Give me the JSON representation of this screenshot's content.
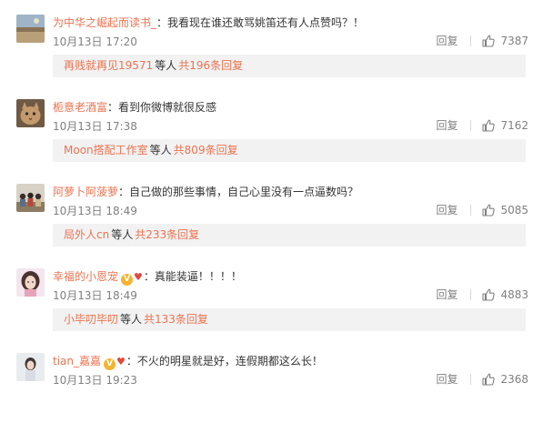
{
  "comments": [
    {
      "user": "为中华之崛起而读书_",
      "separator": "：",
      "text": "我看现在谁还敢骂姚笛还有人点赞吗？！",
      "time": "10月13日 17:20",
      "reply_label": "回复",
      "likes": "7387",
      "sub_user": "再贱就再见19571",
      "sub_mid": "等人",
      "sub_count": "共196条回复",
      "avatar_style": "landscape"
    },
    {
      "user": "栀意老酒富",
      "separator": "：",
      "text": "看到你微博就很反感",
      "time": "10月13日 17:38",
      "reply_label": "回复",
      "likes": "7162",
      "sub_user": "Moon搭配工作室",
      "sub_mid": "等人",
      "sub_count": "共809条回复",
      "avatar_style": "cat"
    },
    {
      "user": "阿萝卜阿菠萝",
      "separator": "：",
      "text": "自己做的那些事情，自己心里没有一点逼数吗？",
      "time": "10月13日 18:49",
      "reply_label": "回复",
      "likes": "5085",
      "sub_user": "局外人cn",
      "sub_mid": "等人",
      "sub_count": "共233条回复",
      "avatar_style": "group"
    },
    {
      "user": "幸福的小恩宠",
      "separator": "：",
      "text": "真能装逼！！！！",
      "time": "10月13日 18:49",
      "reply_label": "回复",
      "likes": "4883",
      "sub_user": "小毕叨毕叨",
      "sub_mid": "等人",
      "sub_count": "共133条回复",
      "avatar_style": "girl",
      "badge": "v-heart"
    },
    {
      "user": "tian_嘉嘉",
      "separator": "：",
      "text": "不火的明星就是好，连假期都这么长！",
      "time": "10月13日 19:23",
      "reply_label": "回复",
      "likes": "2368",
      "avatar_style": "portrait",
      "badge": "v-heart"
    }
  ],
  "colors": {
    "link": "#eb7350",
    "meta": "#808080",
    "sub_bg": "#f2f2f2"
  },
  "icons": {
    "like": "thumb-up-icon",
    "badge_v": "member-v-icon",
    "badge_heart": "heart-icon"
  }
}
